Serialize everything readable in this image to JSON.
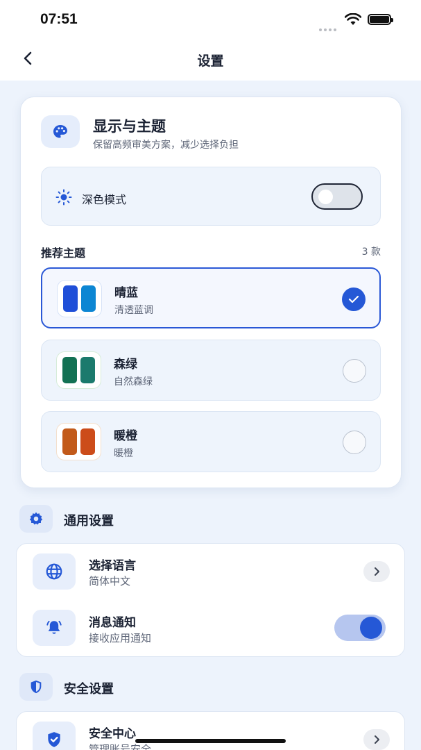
{
  "status_bar": {
    "time": "07:51"
  },
  "nav": {
    "title": "设置"
  },
  "display_section": {
    "title": "显示与主题",
    "subtitle": "保留高频审美方案，减少选择负担",
    "dark_mode": {
      "label": "深色模式",
      "enabled": false
    },
    "themes_heading": "推荐主题",
    "themes_count": "3 款",
    "themes": [
      {
        "name": "晴蓝",
        "desc": "清透蓝调",
        "colors": [
          "#1f4fd8",
          "#0c86d3"
        ],
        "selected": true
      },
      {
        "name": "森绿",
        "desc": "自然森绿",
        "colors": [
          "#127153",
          "#1b7a6d"
        ],
        "selected": false
      },
      {
        "name": "暖橙",
        "desc": "暖橙",
        "colors": [
          "#c25a1a",
          "#cc4c1a"
        ],
        "selected": false
      }
    ]
  },
  "general_section": {
    "label": "通用设置",
    "items": [
      {
        "title": "选择语言",
        "subtitle": "简体中文",
        "control": "chevron"
      },
      {
        "title": "消息通知",
        "subtitle": "接收应用通知",
        "control": "toggle",
        "enabled": true
      }
    ]
  },
  "security_section": {
    "label": "安全设置",
    "items": [
      {
        "title": "安全中心",
        "subtitle": "管理账号安全",
        "control": "chevron"
      }
    ]
  },
  "colors": {
    "accent": "#2558d6",
    "background": "#edf3fc",
    "card": "#ffffff"
  }
}
